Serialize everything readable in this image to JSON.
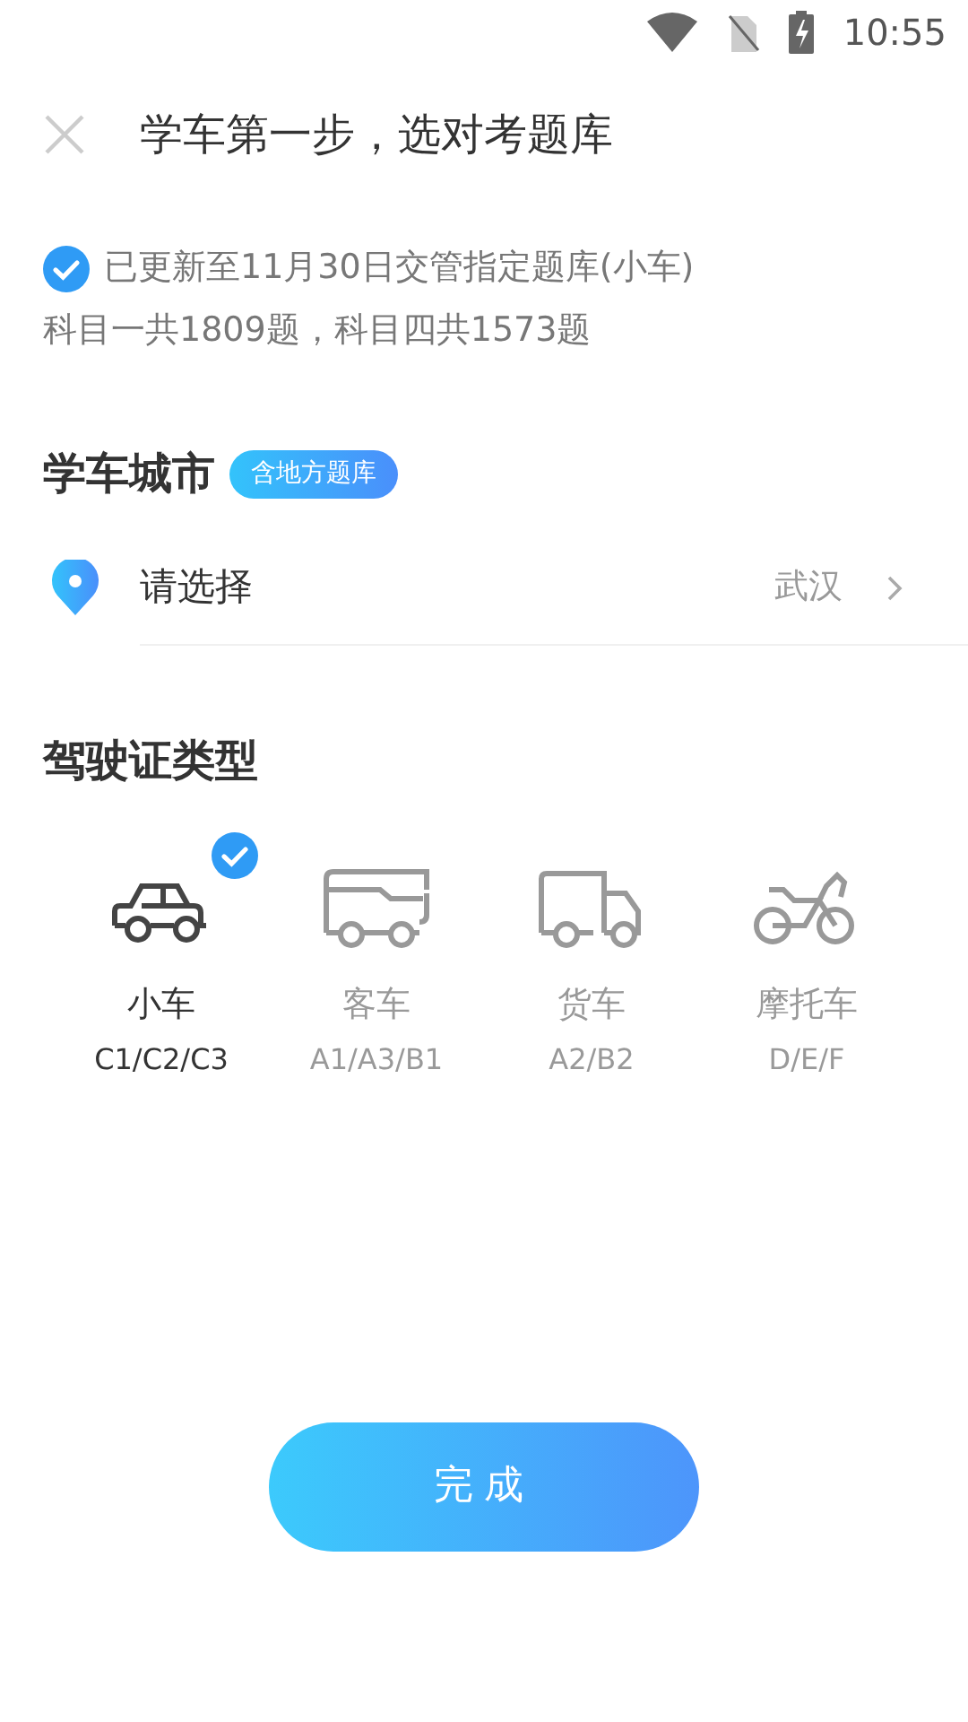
{
  "status_bar": {
    "time": "10:55"
  },
  "header": {
    "title": "学车第一步，选对考题库"
  },
  "notice": {
    "checked": true,
    "line1": "已更新至11月30日交管指定题库(小车)",
    "line2": "科目一共1809题，科目四共1573题"
  },
  "city": {
    "heading": "学车城市",
    "badge": "含地方题库",
    "label": "请选择",
    "value": "武汉"
  },
  "license": {
    "heading": "驾驶证类型",
    "vehicles": [
      {
        "kind": "car",
        "name": "小车",
        "codes": "C1/C2/C3",
        "selected": true
      },
      {
        "kind": "bus",
        "name": "客车",
        "codes": "A1/A3/B1",
        "selected": false
      },
      {
        "kind": "truck",
        "name": "货车",
        "codes": "A2/B2",
        "selected": false
      },
      {
        "kind": "motorcycle",
        "name": "摩托车",
        "codes": "D/E/F",
        "selected": false
      }
    ]
  },
  "done_button": {
    "label": "完成"
  }
}
